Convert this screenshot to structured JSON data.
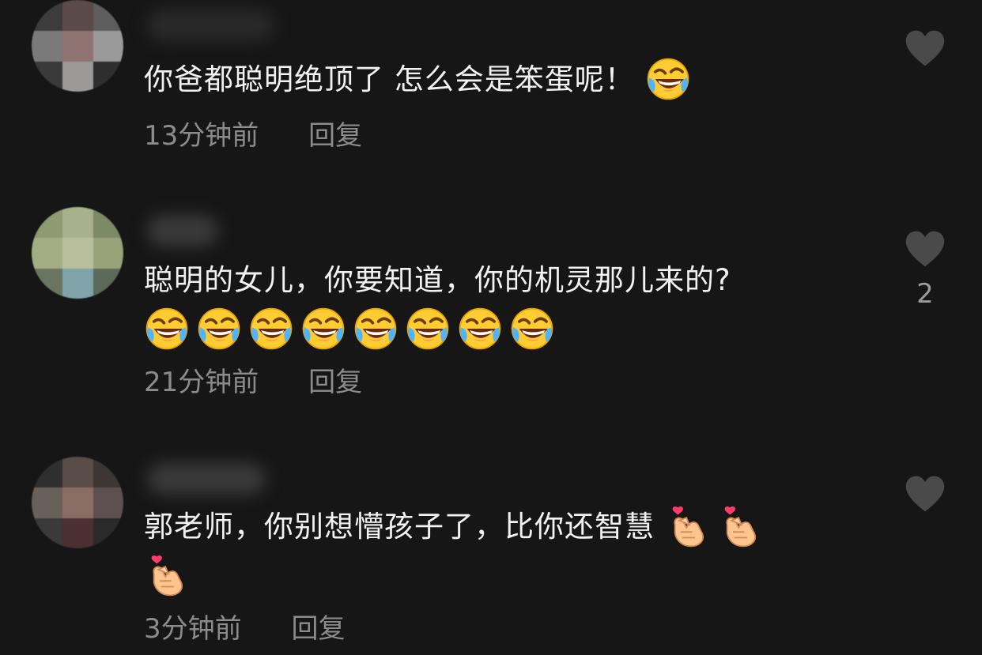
{
  "comments": [
    {
      "text": "你爸都聪明绝顶了 怎么会是笨蛋呢！",
      "emojis": [
        "rolling-laughing-emoji"
      ],
      "time": "13分钟前",
      "reply": "回复",
      "likes": ""
    },
    {
      "text": "聪明的女儿，你要知道，你的机灵那儿来的?",
      "emojis": [
        "rolling-laughing-emoji",
        "rolling-laughing-emoji",
        "rolling-laughing-emoji",
        "rolling-laughing-emoji",
        "rolling-laughing-emoji",
        "rolling-laughing-emoji",
        "rolling-laughing-emoji",
        "rolling-laughing-emoji"
      ],
      "time": "21分钟前",
      "reply": "回复",
      "likes": "2"
    },
    {
      "text": "郭老师，你别想懵孩子了，比你还智慧",
      "emojis": [
        "finger-heart-emoji",
        "finger-heart-emoji",
        "finger-heart-emoji"
      ],
      "time": "3分钟前",
      "reply": "回复",
      "likes": ""
    }
  ],
  "colors": {
    "background": "#161616",
    "text": "#f2f2f2",
    "meta": "#8c8c8c",
    "heart": "#4a4a4a"
  }
}
